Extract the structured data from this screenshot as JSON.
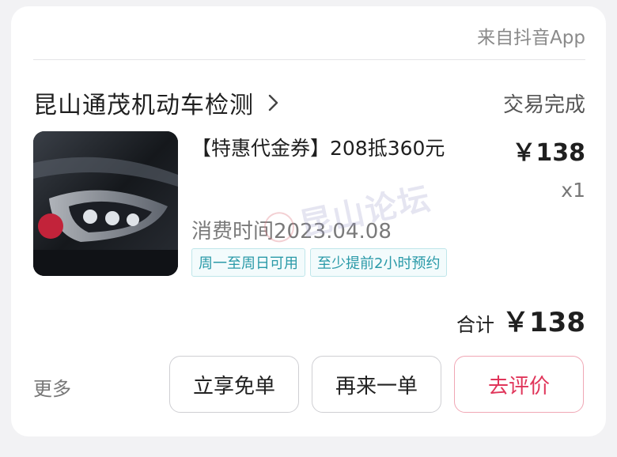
{
  "card": {
    "source": "来自抖音App",
    "shop_name": "昆山通茂机动车检测",
    "status": "交易完成",
    "product": {
      "title": "【特惠代金券】208抵360元",
      "price": "￥138",
      "quantity": "x1",
      "consume_time": "消费时间2023.04.08",
      "tags": [
        "周一至周日可用",
        "至少提前2小时预约"
      ]
    },
    "total": {
      "label": "合计",
      "value": "￥138"
    },
    "more_label": "更多",
    "buttons": {
      "free": "立享免单",
      "again": "再来一单",
      "review": "去评价"
    }
  },
  "watermark_text": "昆山论坛",
  "colors": {
    "accent_review": "#e0355a",
    "tag_text": "#2a9aa8"
  }
}
